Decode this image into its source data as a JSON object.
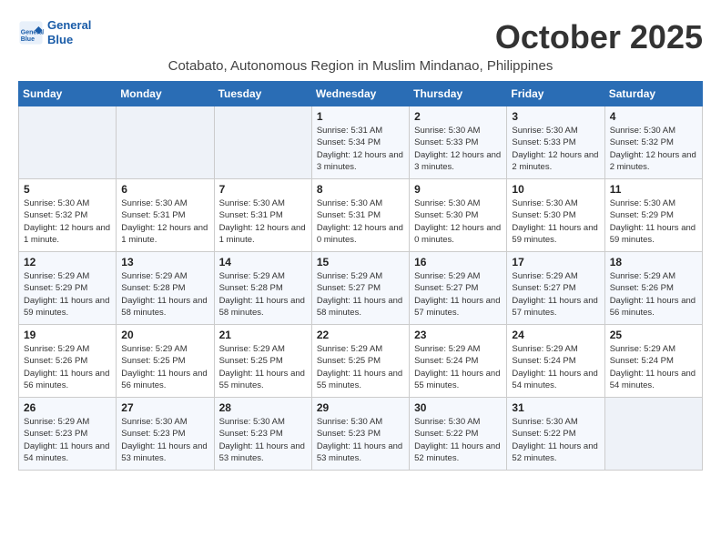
{
  "header": {
    "logo_line1": "General",
    "logo_line2": "Blue",
    "month_title": "October 2025",
    "subtitle": "Cotabato, Autonomous Region in Muslim Mindanao, Philippines"
  },
  "weekdays": [
    "Sunday",
    "Monday",
    "Tuesday",
    "Wednesday",
    "Thursday",
    "Friday",
    "Saturday"
  ],
  "weeks": [
    [
      {
        "day": "",
        "info": ""
      },
      {
        "day": "",
        "info": ""
      },
      {
        "day": "",
        "info": ""
      },
      {
        "day": "1",
        "info": "Sunrise: 5:31 AM\nSunset: 5:34 PM\nDaylight: 12 hours and 3 minutes."
      },
      {
        "day": "2",
        "info": "Sunrise: 5:30 AM\nSunset: 5:33 PM\nDaylight: 12 hours and 3 minutes."
      },
      {
        "day": "3",
        "info": "Sunrise: 5:30 AM\nSunset: 5:33 PM\nDaylight: 12 hours and 2 minutes."
      },
      {
        "day": "4",
        "info": "Sunrise: 5:30 AM\nSunset: 5:32 PM\nDaylight: 12 hours and 2 minutes."
      }
    ],
    [
      {
        "day": "5",
        "info": "Sunrise: 5:30 AM\nSunset: 5:32 PM\nDaylight: 12 hours and 1 minute."
      },
      {
        "day": "6",
        "info": "Sunrise: 5:30 AM\nSunset: 5:31 PM\nDaylight: 12 hours and 1 minute."
      },
      {
        "day": "7",
        "info": "Sunrise: 5:30 AM\nSunset: 5:31 PM\nDaylight: 12 hours and 1 minute."
      },
      {
        "day": "8",
        "info": "Sunrise: 5:30 AM\nSunset: 5:31 PM\nDaylight: 12 hours and 0 minutes."
      },
      {
        "day": "9",
        "info": "Sunrise: 5:30 AM\nSunset: 5:30 PM\nDaylight: 12 hours and 0 minutes."
      },
      {
        "day": "10",
        "info": "Sunrise: 5:30 AM\nSunset: 5:30 PM\nDaylight: 11 hours and 59 minutes."
      },
      {
        "day": "11",
        "info": "Sunrise: 5:30 AM\nSunset: 5:29 PM\nDaylight: 11 hours and 59 minutes."
      }
    ],
    [
      {
        "day": "12",
        "info": "Sunrise: 5:29 AM\nSunset: 5:29 PM\nDaylight: 11 hours and 59 minutes."
      },
      {
        "day": "13",
        "info": "Sunrise: 5:29 AM\nSunset: 5:28 PM\nDaylight: 11 hours and 58 minutes."
      },
      {
        "day": "14",
        "info": "Sunrise: 5:29 AM\nSunset: 5:28 PM\nDaylight: 11 hours and 58 minutes."
      },
      {
        "day": "15",
        "info": "Sunrise: 5:29 AM\nSunset: 5:27 PM\nDaylight: 11 hours and 58 minutes."
      },
      {
        "day": "16",
        "info": "Sunrise: 5:29 AM\nSunset: 5:27 PM\nDaylight: 11 hours and 57 minutes."
      },
      {
        "day": "17",
        "info": "Sunrise: 5:29 AM\nSunset: 5:27 PM\nDaylight: 11 hours and 57 minutes."
      },
      {
        "day": "18",
        "info": "Sunrise: 5:29 AM\nSunset: 5:26 PM\nDaylight: 11 hours and 56 minutes."
      }
    ],
    [
      {
        "day": "19",
        "info": "Sunrise: 5:29 AM\nSunset: 5:26 PM\nDaylight: 11 hours and 56 minutes."
      },
      {
        "day": "20",
        "info": "Sunrise: 5:29 AM\nSunset: 5:25 PM\nDaylight: 11 hours and 56 minutes."
      },
      {
        "day": "21",
        "info": "Sunrise: 5:29 AM\nSunset: 5:25 PM\nDaylight: 11 hours and 55 minutes."
      },
      {
        "day": "22",
        "info": "Sunrise: 5:29 AM\nSunset: 5:25 PM\nDaylight: 11 hours and 55 minutes."
      },
      {
        "day": "23",
        "info": "Sunrise: 5:29 AM\nSunset: 5:24 PM\nDaylight: 11 hours and 55 minutes."
      },
      {
        "day": "24",
        "info": "Sunrise: 5:29 AM\nSunset: 5:24 PM\nDaylight: 11 hours and 54 minutes."
      },
      {
        "day": "25",
        "info": "Sunrise: 5:29 AM\nSunset: 5:24 PM\nDaylight: 11 hours and 54 minutes."
      }
    ],
    [
      {
        "day": "26",
        "info": "Sunrise: 5:29 AM\nSunset: 5:23 PM\nDaylight: 11 hours and 54 minutes."
      },
      {
        "day": "27",
        "info": "Sunrise: 5:30 AM\nSunset: 5:23 PM\nDaylight: 11 hours and 53 minutes."
      },
      {
        "day": "28",
        "info": "Sunrise: 5:30 AM\nSunset: 5:23 PM\nDaylight: 11 hours and 53 minutes."
      },
      {
        "day": "29",
        "info": "Sunrise: 5:30 AM\nSunset: 5:23 PM\nDaylight: 11 hours and 53 minutes."
      },
      {
        "day": "30",
        "info": "Sunrise: 5:30 AM\nSunset: 5:22 PM\nDaylight: 11 hours and 52 minutes."
      },
      {
        "day": "31",
        "info": "Sunrise: 5:30 AM\nSunset: 5:22 PM\nDaylight: 11 hours and 52 minutes."
      },
      {
        "day": "",
        "info": ""
      }
    ]
  ]
}
